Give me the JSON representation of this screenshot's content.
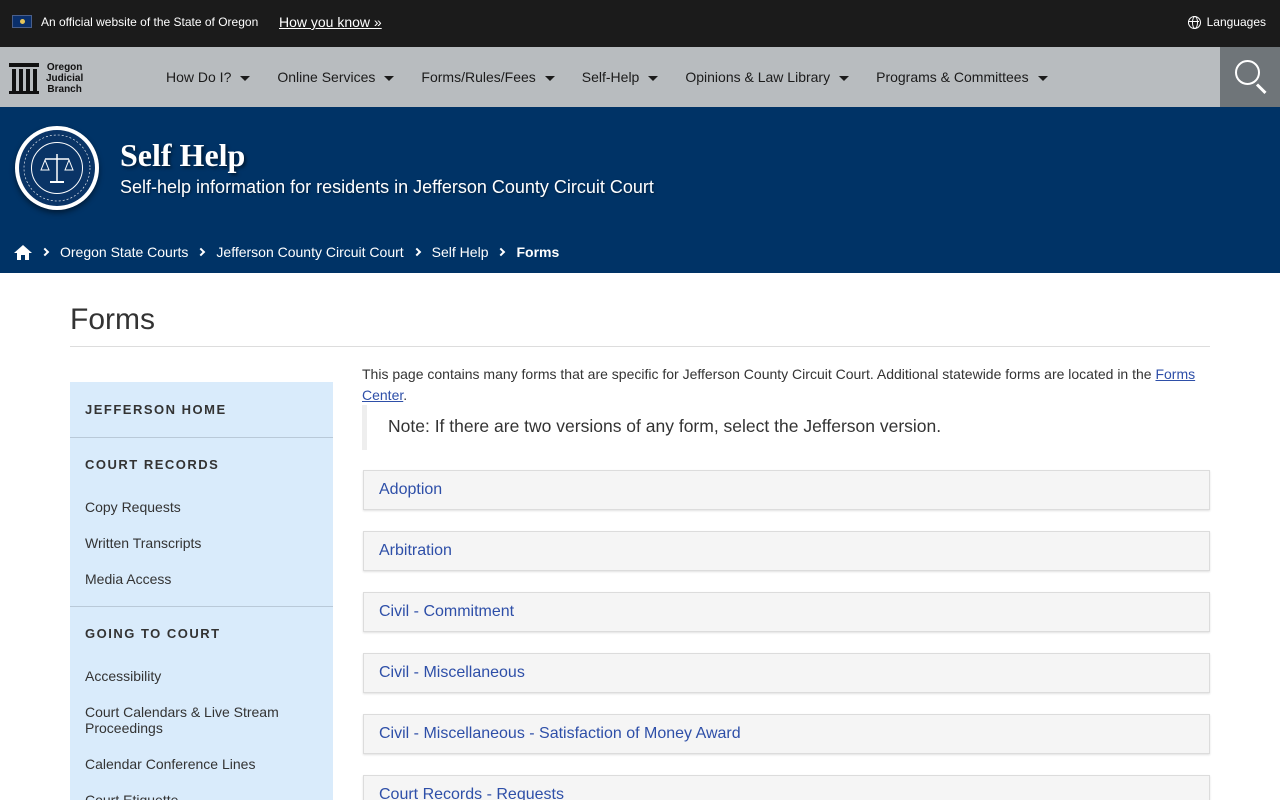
{
  "official_bar": {
    "text": "An official website of the State of Oregon",
    "how_you_know": "How you know »",
    "languages": "Languages"
  },
  "logo": {
    "line1": "Oregon",
    "line2": "Judicial",
    "line3": "Branch"
  },
  "nav": {
    "items": [
      {
        "label": "How Do I?"
      },
      {
        "label": "Online Services"
      },
      {
        "label": "Forms/Rules/Fees"
      },
      {
        "label": "Self-Help"
      },
      {
        "label": "Opinions & Law Library"
      },
      {
        "label": "Programs & Committees"
      }
    ]
  },
  "hero": {
    "title": "Self Help",
    "subtitle": "Self-help information for residents in Jefferson County Circuit Court"
  },
  "breadcrumb": {
    "items": [
      "Oregon State Courts",
      "Jefferson County Circuit Court",
      "Self Help"
    ],
    "current": "Forms"
  },
  "page": {
    "title": "Forms",
    "intro_text": "This page contains many forms that are specific for Jefferson County Circuit Court. Additional statewide forms are located in the ",
    "intro_link": "Forms Center",
    "intro_end": ".",
    "note": "Note: If there are two versions of any form, select the Jefferson version."
  },
  "sidebar": {
    "home": "JEFFERSON HOME",
    "court_records": {
      "heading": "COURT RECORDS",
      "links": [
        "Copy Requests",
        "Written Transcripts",
        "Media Access"
      ]
    },
    "going_to_court": {
      "heading": "GOING TO COURT",
      "links": [
        "Accessibility",
        "Court Calendars & Live Stream Proceedings",
        "Calendar Conference Lines",
        "Court Etiquette"
      ]
    }
  },
  "accordions": [
    "Adoption",
    "Arbitration",
    "Civil - Commitment",
    "Civil - Miscellaneous",
    "Civil - Miscellaneous - Satisfaction of Money Award",
    "Court Records - Requests"
  ],
  "colors": {
    "official_bar": "#1b1b1b",
    "nav_bg": "#b8bcbf",
    "hero_bg": "#003366",
    "sidebar_bg": "#d9ebfb",
    "link": "#2e4fa8"
  }
}
